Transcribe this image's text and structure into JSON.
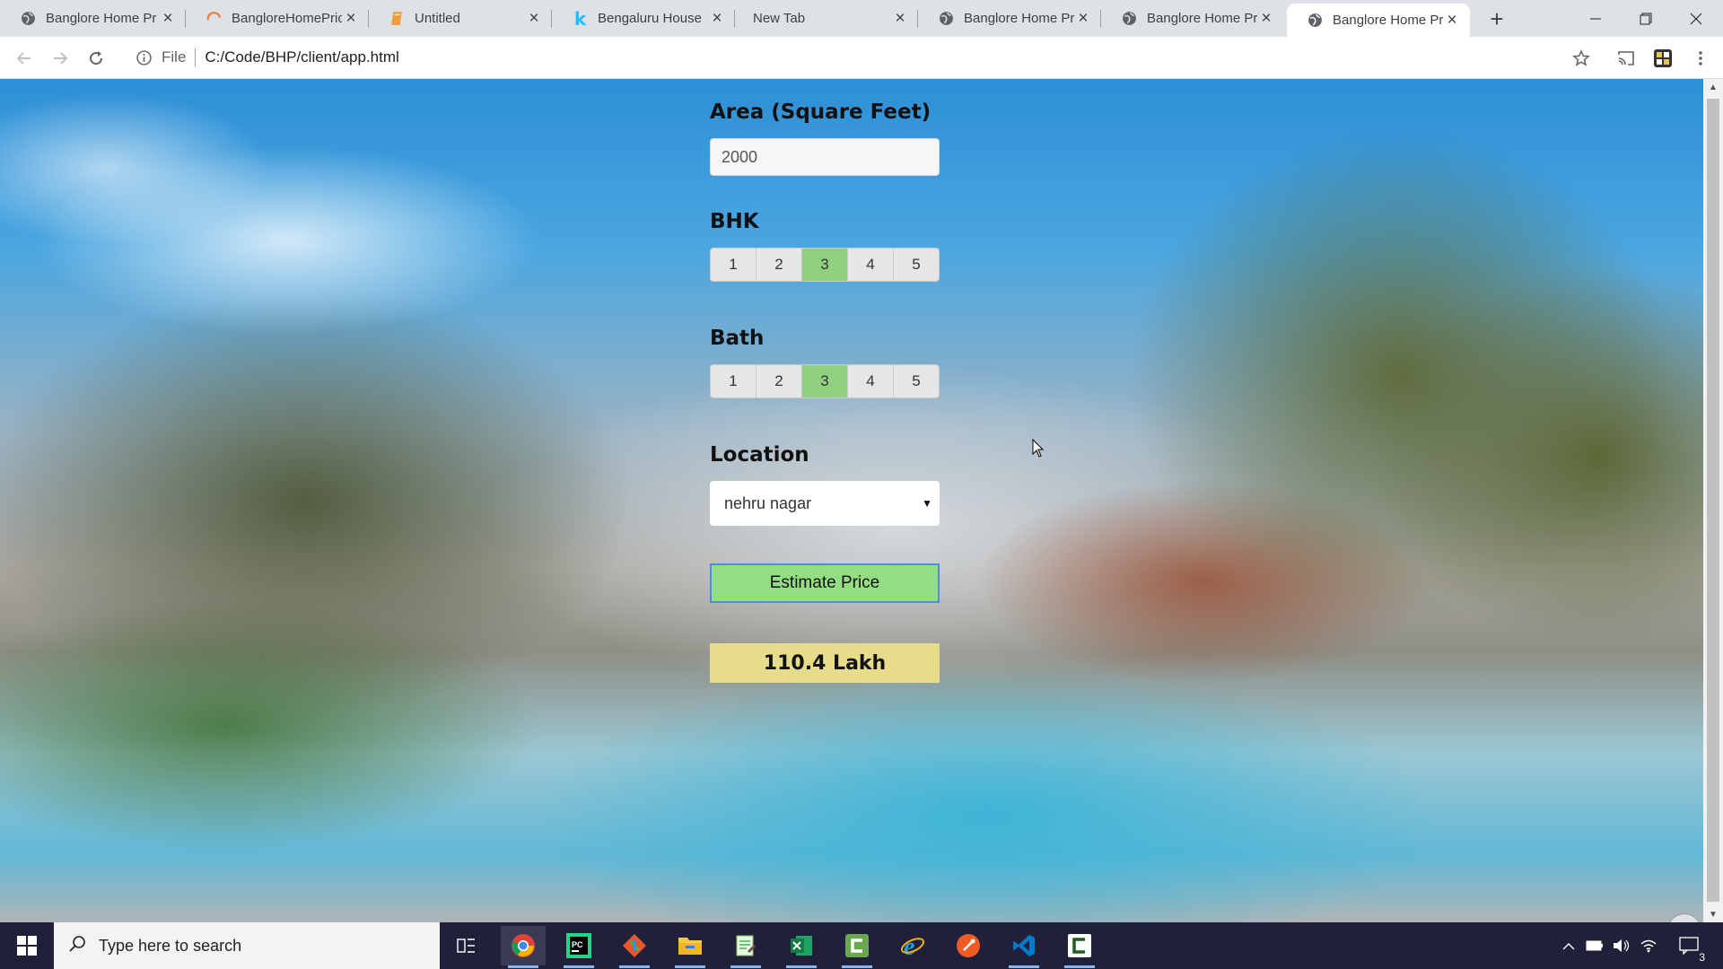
{
  "browser": {
    "tabs": [
      {
        "title": "Banglore Home Pr",
        "icon": "globe-icon"
      },
      {
        "title": "BangloreHomePric",
        "icon": "loading-icon"
      },
      {
        "title": "Untitled",
        "icon": "notebook-icon"
      },
      {
        "title": "Bengaluru House",
        "icon": "kaggle-icon"
      },
      {
        "title": "New Tab",
        "icon": ""
      },
      {
        "title": "Banglore Home Pr",
        "icon": "globe-icon"
      },
      {
        "title": "Banglore Home Pr",
        "icon": "globe-icon"
      },
      {
        "title": "Banglore Home Pr",
        "icon": "globe-icon"
      }
    ],
    "active_tab_index": 7,
    "address": {
      "scheme_label": "File",
      "url": "C:/Code/BHP/client/app.html"
    }
  },
  "form": {
    "area": {
      "label": "Area (Square Feet)",
      "value": "2000"
    },
    "bhk": {
      "label": "BHK",
      "options": [
        "1",
        "2",
        "3",
        "4",
        "5"
      ],
      "selected": "3"
    },
    "bath": {
      "label": "Bath",
      "options": [
        "1",
        "2",
        "3",
        "4",
        "5"
      ],
      "selected": "3"
    },
    "location": {
      "label": "Location",
      "selected": "nehru nagar"
    },
    "estimate_button": "Estimate Price",
    "result": "110.4 Lakh"
  },
  "taskbar": {
    "search_placeholder": "Type here to search",
    "apps": [
      "chrome",
      "pycharm",
      "git",
      "file-explorer",
      "notepad",
      "excel",
      "camtasia",
      "internet-explorer",
      "postman",
      "vscode",
      "camtasia-recorder"
    ],
    "notification_count": "3"
  },
  "colors": {
    "selected_option": "#8fd17f",
    "estimate_button": "#95dd82",
    "result_background": "#e6dc8c",
    "taskbar": "#20203a"
  }
}
